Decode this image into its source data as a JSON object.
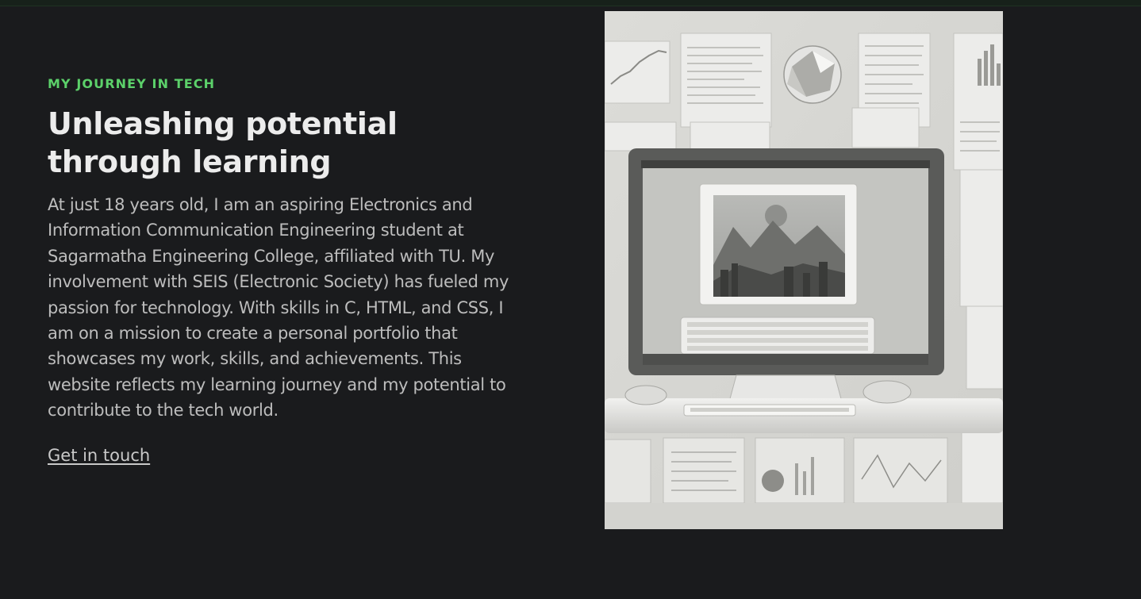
{
  "section": {
    "eyebrow": "MY JOURNEY IN TECH",
    "headline": "Unleashing potential through learning",
    "body": "At just 18 years old, I am an aspiring Electronics and Information Communication Engineering student at Sagarmatha Engineering College, affiliated with TU. My involvement with SEIS (Electronic Society) has fueled my passion for technology. With skills in C, HTML, and CSS, I am on a mission to create a personal portfolio that showcases my work, skills, and achievements. This website reflects my learning journey and my potential to contribute to the tech world.",
    "cta_label": "Get in touch"
  },
  "image": {
    "description": "hero-illustration-computer"
  },
  "colors": {
    "background": "#1a1b1d",
    "accent": "#5cd16a",
    "headline": "#ececec",
    "body": "#bdbdbd"
  }
}
